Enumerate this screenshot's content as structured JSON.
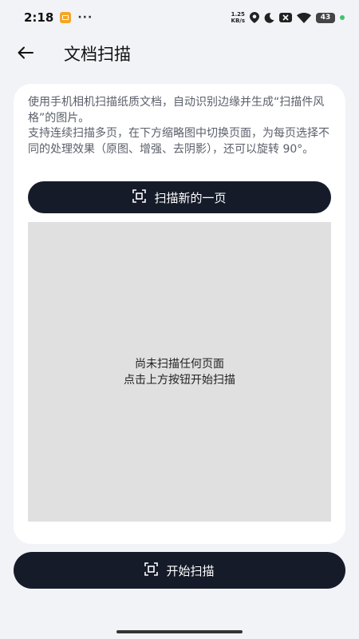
{
  "status_bar": {
    "time": "2:18",
    "dots": "···",
    "net_speed_value": "1.25",
    "net_speed_unit": "KB/s",
    "battery": "43"
  },
  "header": {
    "title": "文档扫描"
  },
  "card": {
    "description_1": "使用手机相机扫描纸质文档，自动识别边缘并生成“扫描件风格”的图片。",
    "description_2": "支持连续扫描多页，在下方缩略图中切换页面，为每页选择不同的处理效果（原图、增强、去阴影），还可以旋转 90°。",
    "scan_new_page_label": "扫描新的一页",
    "empty_line_1": "尚未扫描任何页面",
    "empty_line_2": "点击上方按钮开始扫描"
  },
  "footer": {
    "start_scan_label": "开始扫描"
  },
  "colors": {
    "background": "#f2f3f7",
    "card": "#ffffff",
    "button": "#161b29",
    "preview": "#e0e0e0"
  },
  "icons": [
    "notification-icon",
    "location-icon",
    "moon-icon",
    "close-box-icon",
    "wifi-icon",
    "battery-icon",
    "back-arrow-icon",
    "scan-icon"
  ]
}
